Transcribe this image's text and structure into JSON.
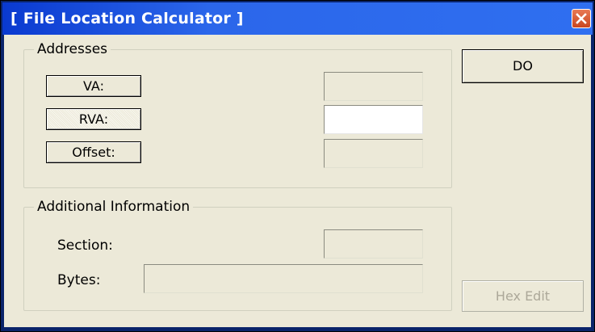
{
  "window": {
    "title": "[ File Location Calculator ]",
    "close_glyph": "✕"
  },
  "addresses": {
    "group_label": "Addresses",
    "va_label": "VA:",
    "rva_label": "RVA:",
    "offset_label": "Offset:",
    "va_value": "",
    "rva_value": "",
    "offset_value": ""
  },
  "additional": {
    "group_label": "Additional Information",
    "section_label": "Section:",
    "bytes_label": "Bytes:",
    "section_value": "",
    "bytes_value": ""
  },
  "buttons": {
    "do_label": "DO",
    "hex_edit_label": "Hex Edit"
  },
  "colors": {
    "titlebar": "#2b66ea",
    "close": "#d95a2e",
    "dialog_bg": "#ece9d8"
  }
}
